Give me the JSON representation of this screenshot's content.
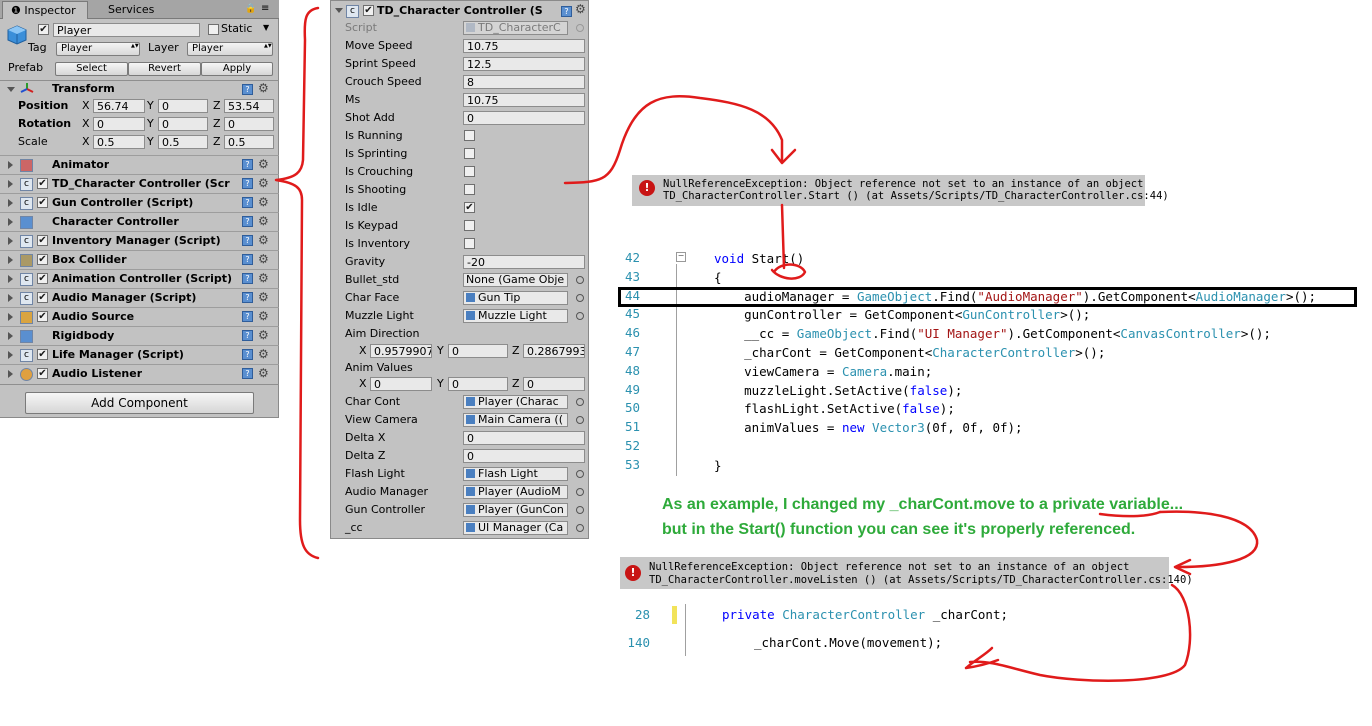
{
  "inspector": {
    "tabs": [
      "Inspector",
      "Services"
    ],
    "object_name": "Player",
    "static_label": "Static",
    "tag_label": "Tag",
    "tag_value": "Player",
    "layer_label": "Layer",
    "layer_value": "Player",
    "prefab_label": "Prefab",
    "prefab_buttons": [
      "Select",
      "Revert",
      "Apply"
    ],
    "transform": {
      "title": "Transform",
      "position_label": "Position",
      "rotation_label": "Rotation",
      "scale_label": "Scale",
      "position": [
        "56.74",
        "0",
        "53.54"
      ],
      "rotation": [
        "0",
        "0",
        "0"
      ],
      "scale": [
        "0.5",
        "0.5",
        "0.5"
      ]
    },
    "components": [
      {
        "name": "Animator",
        "checkbox": false
      },
      {
        "name": "TD_Character Controller (Scr",
        "checkbox": true
      },
      {
        "name": "Gun Controller (Script)",
        "checkbox": true
      },
      {
        "name": "Character Controller",
        "checkbox": false
      },
      {
        "name": "Inventory Manager (Script)",
        "checkbox": true
      },
      {
        "name": "Box Collider",
        "checkbox": true
      },
      {
        "name": "Animation Controller (Script)",
        "checkbox": true
      },
      {
        "name": "Audio Manager (Script)",
        "checkbox": true
      },
      {
        "name": "Audio Source",
        "checkbox": true
      },
      {
        "name": "Rigidbody",
        "checkbox": false
      },
      {
        "name": "Life Manager (Script)",
        "checkbox": true
      },
      {
        "name": "Audio Listener",
        "checkbox": true
      }
    ],
    "add_component": "Add Component"
  },
  "td_panel": {
    "title": "TD_Character Controller (S",
    "script_label": "Script",
    "script_value": "TD_CharacterC",
    "fields": [
      {
        "label": "Move Speed",
        "value": "10.75"
      },
      {
        "label": "Sprint Speed",
        "value": "12.5"
      },
      {
        "label": "Crouch Speed",
        "value": "8"
      },
      {
        "label": "Ms",
        "value": "10.75"
      },
      {
        "label": "Shot Add",
        "value": "0"
      }
    ],
    "bools": [
      {
        "label": "Is Running",
        "checked": false
      },
      {
        "label": "Is Sprinting",
        "checked": false
      },
      {
        "label": "Is Crouching",
        "checked": false
      },
      {
        "label": "Is Shooting",
        "checked": false
      },
      {
        "label": "Is Idle",
        "checked": true
      },
      {
        "label": "Is Keypad",
        "checked": false
      },
      {
        "label": "Is Inventory",
        "checked": false
      }
    ],
    "gravity_label": "Gravity",
    "gravity_value": "-20",
    "objects1": [
      {
        "label": "Bullet_std",
        "value": "None (Game Obje"
      },
      {
        "label": "Char Face",
        "value": "Gun Tip"
      },
      {
        "label": "Muzzle Light",
        "value": "Muzzle Light"
      }
    ],
    "aim_label": "Aim Direction",
    "aim": [
      "0.9579907",
      "0",
      "0.2867993"
    ],
    "anim_label": "Anim Values",
    "anim": [
      "0",
      "0",
      "0"
    ],
    "objects2": [
      {
        "label": "Char Cont",
        "value": "Player (Charac"
      },
      {
        "label": "View Camera",
        "value": "Main Camera (("
      }
    ],
    "deltas": [
      {
        "label": "Delta X",
        "value": "0"
      },
      {
        "label": "Delta Z",
        "value": "0"
      }
    ],
    "objects3": [
      {
        "label": "Flash Light",
        "value": "Flash Light"
      },
      {
        "label": "Audio Manager",
        "value": "Player (AudioM"
      },
      {
        "label": "Gun Controller",
        "value": "Player (GunCon"
      },
      {
        "label": "_cc",
        "value": "UI Manager (Ca"
      }
    ]
  },
  "error1": {
    "line1": "NullReferenceException: Object reference not set to an instance of an object",
    "line2": "TD_CharacterController.Start () (at Assets/Scripts/TD_CharacterController.cs:44)"
  },
  "code_block": {
    "line_numbers": [
      "42",
      "43",
      "44",
      "45",
      "46",
      "47",
      "48",
      "49",
      "50",
      "51",
      "52",
      "53"
    ]
  },
  "note": {
    "line1": "As an example, I changed my _charCont.move to a private variable...",
    "line2": "but in the Start() function you can see it's properly referenced."
  },
  "error2": {
    "line1": "NullReferenceException: Object reference not set to an instance of an object",
    "line2": "TD_CharacterController.moveListen () (at Assets/Scripts/TD_CharacterController.cs:140)"
  },
  "code_block2": {
    "line_numbers": [
      "28",
      "140"
    ],
    "lines": [
      "private CharacterController _charCont;",
      "_charCont.Move(movement);"
    ]
  },
  "colors": {
    "annotation": "#e01b1b",
    "note_text": "#2eaa3a",
    "keyword": "#0000ff",
    "type": "#2b91af",
    "string": "#a31515"
  }
}
